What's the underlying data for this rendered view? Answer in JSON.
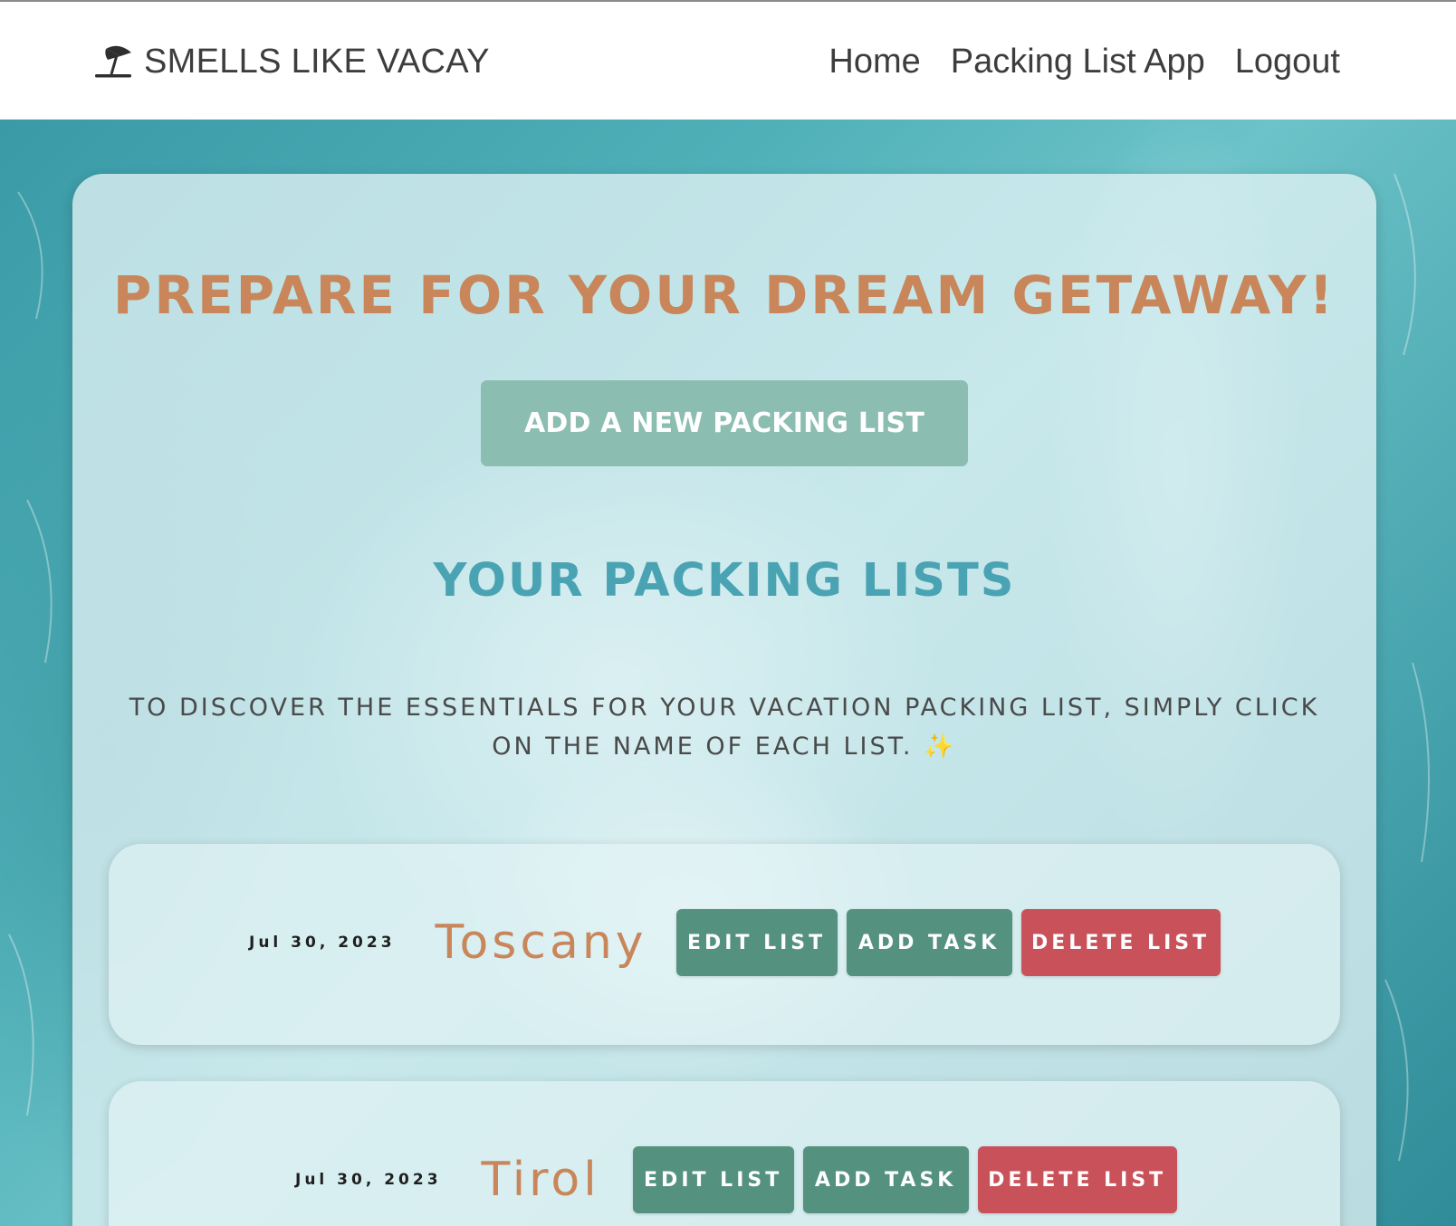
{
  "nav": {
    "brand": "SMELLS LIKE VACAY",
    "brand_icon": "beach-umbrella-icon",
    "links": [
      {
        "label": "Home"
      },
      {
        "label": "Packing List App"
      },
      {
        "label": "Logout"
      }
    ]
  },
  "main": {
    "title": "PREPARE FOR YOUR DREAM GETAWAY!",
    "add_button_label": "ADD A NEW PACKING LIST",
    "section_title": "YOUR PACKING LISTS",
    "instructions": "TO DISCOVER THE ESSENTIALS FOR YOUR VACATION PACKING LIST, SIMPLY CLICK ON THE NAME OF EACH LIST. ✨"
  },
  "lists": [
    {
      "date": "Jul 30, 2023",
      "name": "Toscany",
      "edit_label": "EDIT LIST",
      "add_task_label": "ADD TASK",
      "delete_label": "DELETE LIST"
    },
    {
      "date": "Jul 30, 2023",
      "name": "Tirol",
      "edit_label": "EDIT LIST",
      "add_task_label": "ADD TASK",
      "delete_label": "DELETE LIST"
    }
  ],
  "colors": {
    "title_accent": "#c8865a",
    "section_accent": "#4aa3b3",
    "primary_button": "#8bbdb0",
    "action_green": "#55917f",
    "action_red": "#c9525a"
  }
}
